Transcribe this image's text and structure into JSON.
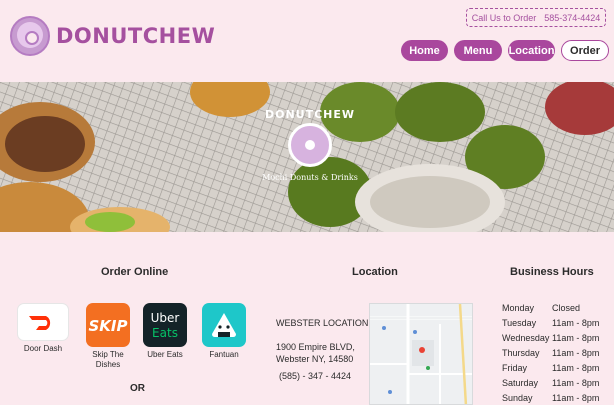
{
  "header": {
    "brand": "DONUTCHEW",
    "call_label": "Call Us to Order",
    "phone": "585-374-4424",
    "nav": [
      {
        "label": "Home"
      },
      {
        "label": "Menu"
      },
      {
        "label": "Location"
      },
      {
        "label": "Order"
      }
    ]
  },
  "hero": {
    "logo_title": "DONUTCHEW",
    "logo_sub": "Mochi Donuts & Drinks"
  },
  "order_online": {
    "title": "Order Online",
    "services": [
      {
        "label": "Door Dash",
        "icon": "doordash-icon",
        "color": "#ff3008"
      },
      {
        "label": "Skip The Dishes",
        "icon": "skip-icon",
        "color": "#f36f21"
      },
      {
        "label": "Uber Eats",
        "icon": "ubereats-icon",
        "color": "#142328"
      },
      {
        "label": "Fantuan",
        "icon": "fantuan-icon",
        "color": "#1ec7c9"
      }
    ],
    "or_label": "OR"
  },
  "location": {
    "title": "Location",
    "name": "WEBSTER LOCATION",
    "address_line1": "1900 Empire BLVD,",
    "address_line2": "Webster NY, 14580",
    "phone": "(585) - 347 - 4424"
  },
  "hours": {
    "title": "Business Hours",
    "rows": [
      {
        "day": "Monday",
        "time": "Closed"
      },
      {
        "day": "Tuesday",
        "time": "11am - 8pm"
      },
      {
        "day": "Wednesday",
        "time": "11am - 8pm"
      },
      {
        "day": "Thursday",
        "time": "11am - 8pm"
      },
      {
        "day": "Friday",
        "time": "11am - 8pm"
      },
      {
        "day": "Saturday",
        "time": "11am - 8pm"
      },
      {
        "day": "Sunday",
        "time": "11am - 8pm"
      }
    ]
  },
  "colors": {
    "brand": "#a5509f",
    "nav": "#a9479d",
    "background": "#fbe9ee"
  }
}
